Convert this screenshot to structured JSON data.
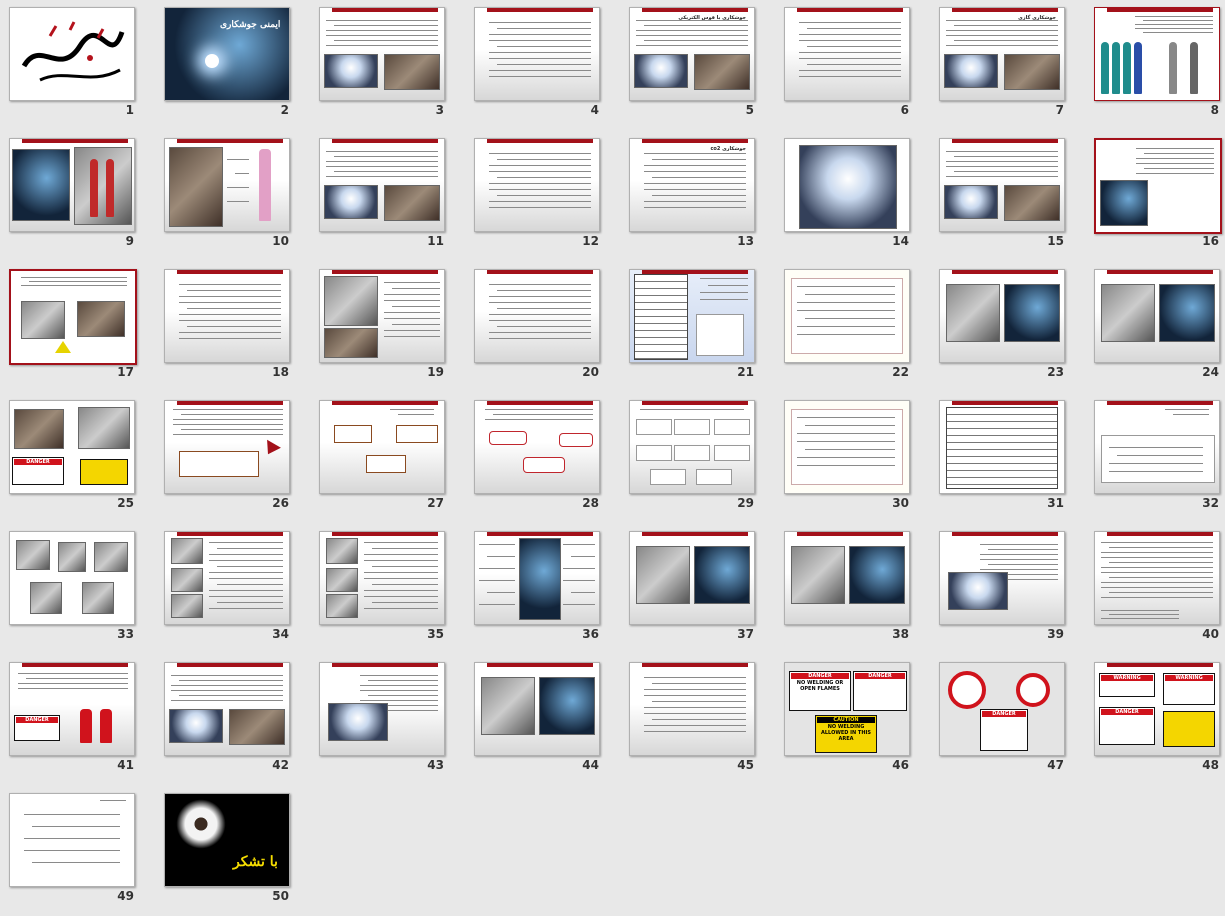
{
  "window": {
    "view": "Slide Sorter"
  },
  "slides": [
    {
      "num": "1",
      "kind": "calligraphy"
    },
    {
      "num": "2",
      "kind": "title-photo",
      "title": "ایمنی جوشکاری"
    },
    {
      "num": "3",
      "kind": "text-2pics"
    },
    {
      "num": "4",
      "kind": "text"
    },
    {
      "num": "5",
      "kind": "text-2pics",
      "title": "جوشکاری با قوس الکتریکی"
    },
    {
      "num": "6",
      "kind": "text"
    },
    {
      "num": "7",
      "kind": "text-2pics",
      "title": "جوشکاری گازی"
    },
    {
      "num": "8",
      "kind": "cylinders"
    },
    {
      "num": "9",
      "kind": "equipment"
    },
    {
      "num": "10",
      "kind": "photo-cylinder"
    },
    {
      "num": "11",
      "kind": "text-2pics"
    },
    {
      "num": "12",
      "kind": "text"
    },
    {
      "num": "13",
      "kind": "text",
      "title": "جوشکاری co2"
    },
    {
      "num": "14",
      "kind": "photo"
    },
    {
      "num": "15",
      "kind": "text-2pics"
    },
    {
      "num": "16",
      "kind": "bordered-pic"
    },
    {
      "num": "17",
      "kind": "bordered-machine"
    },
    {
      "num": "18",
      "kind": "text"
    },
    {
      "num": "19",
      "kind": "diagram-text"
    },
    {
      "num": "20",
      "kind": "text"
    },
    {
      "num": "21",
      "kind": "form-blue"
    },
    {
      "num": "22",
      "kind": "form"
    },
    {
      "num": "23",
      "kind": "two-pics"
    },
    {
      "num": "24",
      "kind": "two-pics"
    },
    {
      "num": "25",
      "kind": "ppe-signs",
      "sign": "DANGER"
    },
    {
      "num": "26",
      "kind": "text-box"
    },
    {
      "num": "27",
      "kind": "boxes"
    },
    {
      "num": "28",
      "kind": "red-boxes"
    },
    {
      "num": "29",
      "kind": "many-boxes"
    },
    {
      "num": "30",
      "kind": "form"
    },
    {
      "num": "31",
      "kind": "table"
    },
    {
      "num": "32",
      "kind": "table-box"
    },
    {
      "num": "33",
      "kind": "ppe"
    },
    {
      "num": "34",
      "kind": "goggles-text"
    },
    {
      "num": "35",
      "kind": "goggles-text"
    },
    {
      "num": "36",
      "kind": "welder-ppe"
    },
    {
      "num": "37",
      "kind": "two-pics"
    },
    {
      "num": "38",
      "kind": "two-pics"
    },
    {
      "num": "39",
      "kind": "text-pic"
    },
    {
      "num": "40",
      "kind": "text-bordered"
    },
    {
      "num": "41",
      "kind": "signs-extinguisher",
      "sign": "DANGER"
    },
    {
      "num": "42",
      "kind": "text-2pics"
    },
    {
      "num": "43",
      "kind": "text-pic"
    },
    {
      "num": "44",
      "kind": "two-pics"
    },
    {
      "num": "45",
      "kind": "text"
    },
    {
      "num": "46",
      "kind": "signs",
      "s1": "DANGER",
      "s1text": "NO WELDING OR OPEN FLAMES",
      "s2": "DANGER",
      "s3": "CAUTION",
      "s3text": "NO WELDING ALLOWED IN THIS AREA"
    },
    {
      "num": "47",
      "kind": "signs2",
      "s1": "DANGER"
    },
    {
      "num": "48",
      "kind": "signs3",
      "s1": "WARNING",
      "s2": "WARNING",
      "s3": "DANGER"
    },
    {
      "num": "49",
      "kind": "text-list"
    },
    {
      "num": "50",
      "kind": "flower",
      "title": "با تشکر"
    }
  ],
  "colors": {
    "accent": "#a3111a",
    "background": "#e8e8e8"
  }
}
